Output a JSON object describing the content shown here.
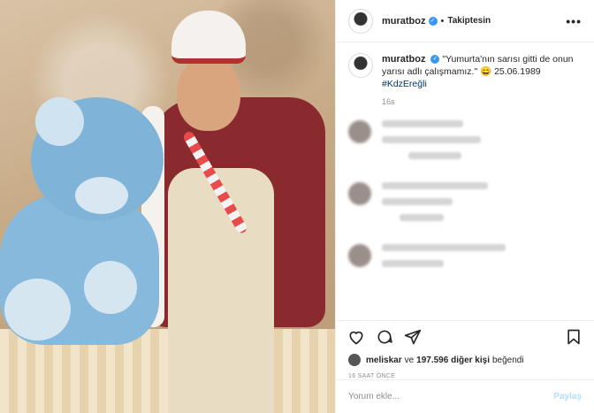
{
  "header": {
    "username": "muratboz",
    "separator": "•",
    "follow_status": "Takiptesin",
    "more": "•••"
  },
  "caption": {
    "username": "muratboz",
    "text": "\"Yumurta'nın sarısı gitti de onun yarısı adlı çalışmamız.\" 😄 25.06.1989",
    "hashtag": "#KdzEreğli",
    "time": "16s"
  },
  "likes": {
    "first_liker": "meliskar",
    "connector": "ve",
    "count": "197.596 diğer kişi",
    "suffix": "beğendi"
  },
  "posted_ago": "16 SAAT ÖNCE",
  "comment_box": {
    "placeholder": "Yorum ekle...",
    "post_label": "Paylaş"
  },
  "icons": [
    "heart-icon",
    "comment-icon",
    "share-icon",
    "bookmark-icon",
    "verified-badge-icon"
  ],
  "colors": {
    "link": "#003569",
    "verified": "#3897f0",
    "post_disabled": "#b2dffc"
  }
}
